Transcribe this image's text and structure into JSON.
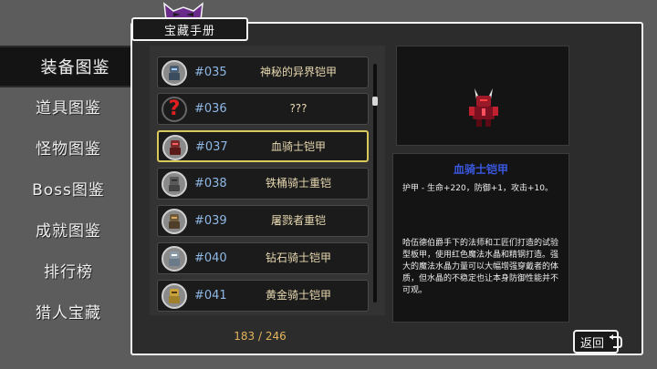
{
  "nav": {
    "items": [
      {
        "label": "装备图鉴",
        "active": true
      },
      {
        "label": "道具图鉴",
        "active": false
      },
      {
        "label": "怪物图鉴",
        "active": false
      },
      {
        "label": "Boss图鉴",
        "active": false
      },
      {
        "label": "成就图鉴",
        "active": false
      },
      {
        "label": "排行榜",
        "active": false
      },
      {
        "label": "猎人宝藏",
        "active": false
      }
    ]
  },
  "header": {
    "title": "宝藏手册"
  },
  "list": {
    "rows": [
      {
        "num": "#035",
        "name": "神秘的异界铠甲",
        "icon": "dark-armor-icon",
        "color": "#4a5c6e"
      },
      {
        "num": "#036",
        "name": "???",
        "icon": "question-mark-icon",
        "color": "#e02020"
      },
      {
        "num": "#037",
        "name": "血骑士铠甲",
        "icon": "blood-armor-icon",
        "color": "#7a2a2a"
      },
      {
        "num": "#038",
        "name": "铁桶骑士重铠",
        "icon": "iron-armor-icon",
        "color": "#5a5a5a"
      },
      {
        "num": "#039",
        "name": "屠戮者重铠",
        "icon": "slayer-armor-icon",
        "color": "#6e5a3a"
      },
      {
        "num": "#040",
        "name": "钻石骑士铠甲",
        "icon": "diamond-armor-icon",
        "color": "#8a9aa8"
      },
      {
        "num": "#041",
        "name": "黄金骑士铠甲",
        "icon": "gold-armor-icon",
        "color": "#c9a23a"
      }
    ],
    "selected_index": 2
  },
  "counter": "183 / 246",
  "detail": {
    "title": "血骑士铠甲",
    "stats": "护甲 - 生命+220，防御+1，攻击+10。",
    "description": "哈伍德伯爵手下的法师和工匠们打造的试验型板甲，使用红色魔法水晶和精钢打造。强大的魔法水晶力量可以大幅增强穿戴者的体质，但水晶的不稳定也让本身防御性能并不可观。"
  },
  "back_button": {
    "label": "返回"
  },
  "colors": {
    "accent_gold": "#e3b45c",
    "number_blue": "#8fb8e6",
    "title_blue": "#3a58e0",
    "selected_border": "#d9c95a"
  }
}
